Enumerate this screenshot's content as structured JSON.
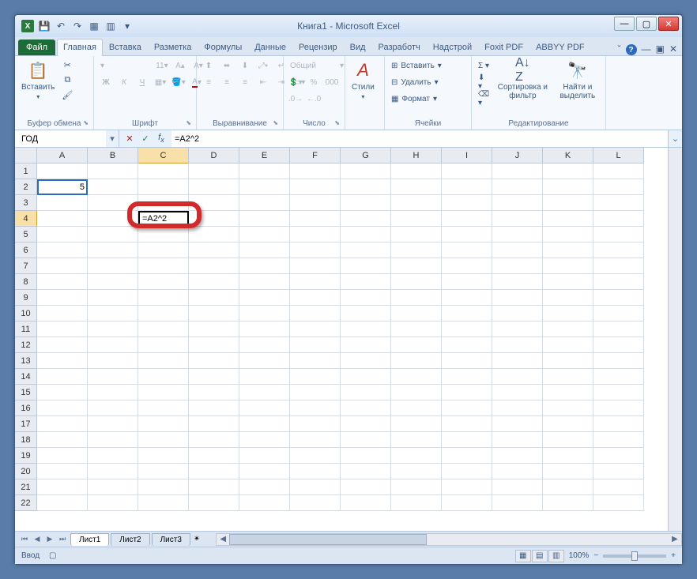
{
  "title": "Книга1 - Microsoft Excel",
  "tabs": {
    "file": "Файл",
    "items": [
      "Главная",
      "Вставка",
      "Разметка",
      "Формулы",
      "Данные",
      "Рецензир",
      "Вид",
      "Разработч",
      "Надстрой",
      "Foxit PDF",
      "ABBYY PDF"
    ],
    "active_index": 0
  },
  "ribbon": {
    "clipboard": {
      "label": "Буфер обмена",
      "paste": "Вставить"
    },
    "font": {
      "label": "Шрифт",
      "size": "11"
    },
    "alignment": {
      "label": "Выравнивание"
    },
    "number": {
      "label": "Число",
      "format": "Общий"
    },
    "styles": {
      "label": "",
      "btn": "Стили"
    },
    "cells": {
      "label": "Ячейки",
      "insert": "Вставить",
      "delete": "Удалить",
      "format": "Формат"
    },
    "editing": {
      "label": "Редактирование",
      "sort": "Сортировка и фильтр",
      "find": "Найти и выделить"
    }
  },
  "namebox": "ГОД",
  "formula": "=A2^2",
  "columns": [
    "A",
    "B",
    "C",
    "D",
    "E",
    "F",
    "G",
    "H",
    "I",
    "J",
    "K",
    "L"
  ],
  "rows_count": 22,
  "active_col_index": 2,
  "active_row": 4,
  "cell_A2": "5",
  "editing_cell_value": "=A2^2",
  "sheets": [
    "Лист1",
    "Лист2",
    "Лист3"
  ],
  "active_sheet": 0,
  "status": "Ввод",
  "zoom": "100%"
}
